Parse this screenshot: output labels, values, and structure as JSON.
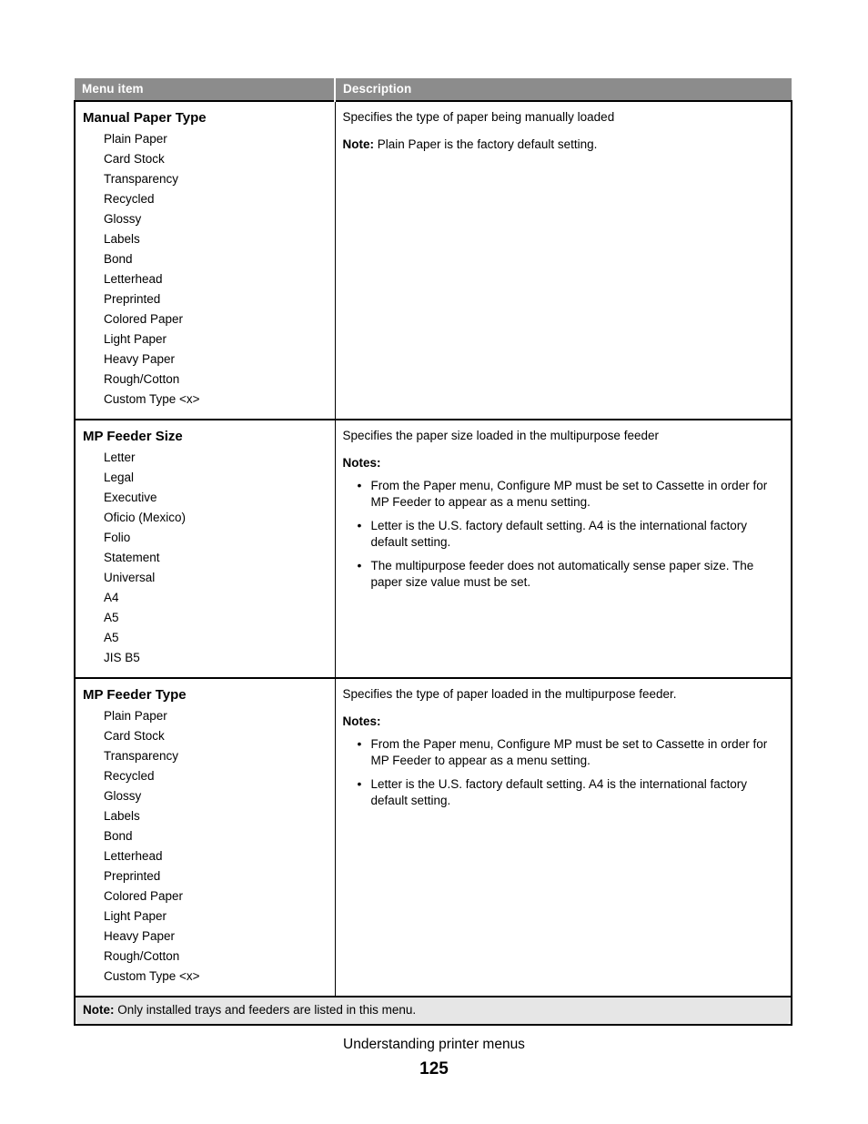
{
  "document": {
    "table": {
      "columns": {
        "menu_item": "Menu item",
        "description": "Description"
      },
      "rows": [
        {
          "title": "Manual Paper Type",
          "options": [
            "Plain Paper",
            "Card Stock",
            "Transparency",
            "Recycled",
            "Glossy",
            "Labels",
            "Bond",
            "Letterhead",
            "Preprinted",
            "Colored Paper",
            "Light Paper",
            "Heavy Paper",
            "Rough/Cotton",
            "Custom Type <x>"
          ],
          "description": {
            "lead": "Specifies the type of paper being manually loaded",
            "note_label": "Note:",
            "note_text": " Plain Paper is the factory default setting.",
            "notes_label": "",
            "bullets": []
          }
        },
        {
          "title": "MP Feeder Size",
          "options": [
            "Letter",
            "Legal",
            "Executive",
            "Oficio (Mexico)",
            "Folio",
            "Statement",
            "Universal",
            "A4",
            "A5",
            "A5",
            "JIS B5"
          ],
          "description": {
            "lead": "Specifies the paper size loaded in the multipurpose feeder",
            "note_label": "",
            "note_text": "",
            "notes_label": "Notes:",
            "bullets": [
              "From the Paper menu, Configure MP must be set to Cassette in order for MP Feeder to appear as a menu setting.",
              "Letter is the U.S. factory default setting. A4 is the international factory default setting.",
              "The multipurpose feeder does not automatically sense paper size. The paper size value must be set."
            ]
          }
        },
        {
          "title": "MP Feeder Type",
          "options": [
            "Plain Paper",
            "Card Stock",
            "Transparency",
            "Recycled",
            "Glossy",
            "Labels",
            "Bond",
            "Letterhead",
            "Preprinted",
            "Colored Paper",
            "Light Paper",
            "Heavy Paper",
            "Rough/Cotton",
            "Custom Type <x>"
          ],
          "description": {
            "lead": "Specifies the type of paper loaded in the multipurpose feeder.",
            "note_label": "",
            "note_text": "",
            "notes_label": "Notes:",
            "bullets": [
              "From the Paper menu, Configure MP must be set to Cassette in order for MP Feeder to appear as a menu setting.",
              "Letter is the U.S. factory default setting. A4 is the international factory default setting."
            ]
          }
        }
      ],
      "footnote": {
        "label": "Note:",
        "text": " Only installed trays and feeders are listed in this menu."
      }
    },
    "footer": {
      "section_title": "Understanding printer menus",
      "page_number": "125"
    },
    "colors": {
      "header_background": "#8c8c8c",
      "header_text": "#ffffff",
      "footnote_background": "#e6e6e6",
      "border": "#000000",
      "page_background": "#ffffff"
    }
  }
}
